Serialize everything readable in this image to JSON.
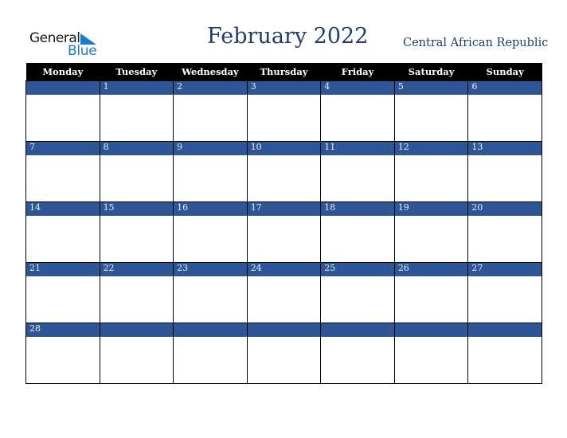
{
  "logo": {
    "line1": "General",
    "line2": "Blue",
    "accent_color": "#1a7cc8"
  },
  "header": {
    "title": "February 2022",
    "country": "Central African Republic"
  },
  "calendar": {
    "weekdays": [
      "Monday",
      "Tuesday",
      "Wednesday",
      "Thursday",
      "Friday",
      "Saturday",
      "Sunday"
    ],
    "weeks": [
      [
        "",
        "1",
        "2",
        "3",
        "4",
        "5",
        "6"
      ],
      [
        "7",
        "8",
        "9",
        "10",
        "11",
        "12",
        "13"
      ],
      [
        "14",
        "15",
        "16",
        "17",
        "18",
        "19",
        "20"
      ],
      [
        "21",
        "22",
        "23",
        "24",
        "25",
        "26",
        "27"
      ],
      [
        "28",
        "",
        "",
        "",
        "",
        "",
        ""
      ]
    ],
    "date_bar_color": "#2e5595",
    "header_color": "#000000"
  }
}
